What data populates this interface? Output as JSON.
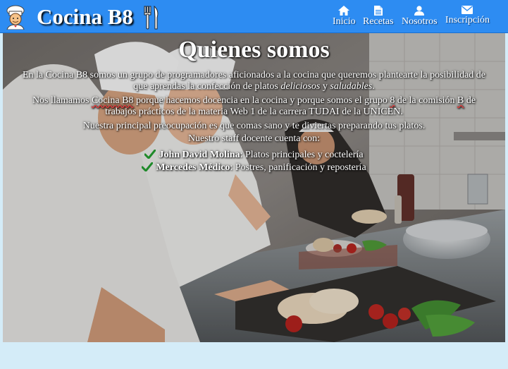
{
  "header": {
    "brand": "Cocina B8",
    "logo_icon": "chef-icon",
    "cutlery_icon": "fork-knife-icon",
    "nav": [
      {
        "label": "Inicio",
        "icon": "home-icon"
      },
      {
        "label": "Recetas",
        "icon": "document-icon"
      },
      {
        "label": "Nosotros",
        "icon": "user-icon"
      },
      {
        "label": "Inscripción",
        "icon": "envelope-icon"
      }
    ]
  },
  "about": {
    "title": "Quienes somos",
    "p1_text": "En la Cocina B8 somos un grupo de programadores aficionados a la cocina que queremos plantearte la posibilidad de que aprendas la confección de platos ",
    "p1_em1": "deliciosos",
    "p1_mid": " y ",
    "p1_em2": "saludables",
    "p1_end": ".",
    "p2_a": "Nos llamamos ",
    "p2_name": "Cocina B8",
    "p2_b": " porque hacemos docencia en la cocina y porque somos el grupo ",
    "p2_group": "8",
    "p2_c": " de la comisión ",
    "p2_comision": "B",
    "p2_d": " de trabajos prácticos de la materia Web 1 de la carrera TUDAI de la UNICEN.",
    "p3": "Nuestra principal preocupación es que comas sano y te diviertas preparando tus platos.",
    "p4": "Nuestro staff docente cuenta con:",
    "staff": [
      {
        "name": "John David Molina",
        "role": ": Platos principales y coctelería"
      },
      {
        "name": "Mercedes Médico",
        "role": ": Postres, panificación y repostería"
      }
    ]
  },
  "colors": {
    "navbar": "#2d8cf2",
    "page_background": "#d4ecf8",
    "check": "#1f8a2a"
  }
}
